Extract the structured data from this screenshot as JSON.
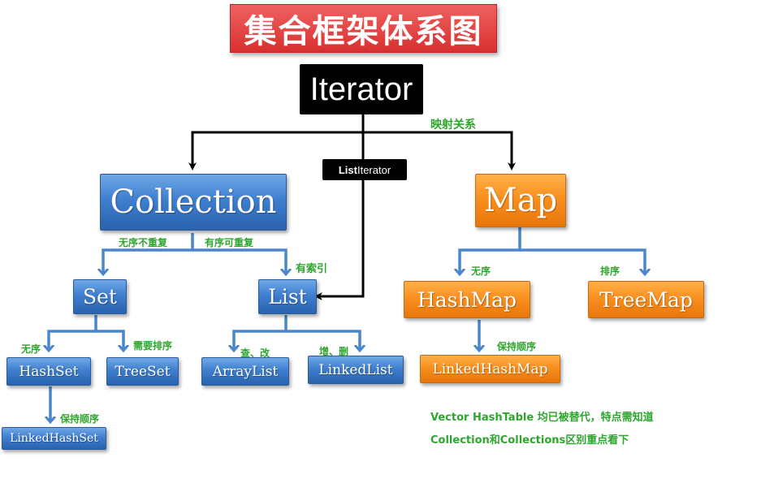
{
  "title": "集合框架体系图",
  "nodes": {
    "iterator": "Iterator",
    "list_iterator_bold": "List",
    "list_iterator_rest": "Iterator",
    "collection": "Collection",
    "map": "Map",
    "set": "Set",
    "list": "List",
    "hashset": "HashSet",
    "treeset": "TreeSet",
    "arraylist": "ArrayList",
    "linkedlist": "LinkedList",
    "linkedhashset": "LinkedHashSet",
    "hashmap": "HashMap",
    "treemap": "TreeMap",
    "linkedhashmap": "LinkedHashMap"
  },
  "labels": {
    "mapping": "映射关系",
    "unordered_no_dup": "无序不重复",
    "ordered_dup": "有序可重复",
    "indexed": "有索引",
    "set_unordered": "无序",
    "needs_sort": "需要排序",
    "query_modify": "查、改",
    "add_delete": "增、删",
    "keep_order_set": "保持顺序",
    "map_unordered": "无序",
    "map_sorted": "排序",
    "keep_order_map": "保持顺序"
  },
  "notes": {
    "line1": "Vector HashTable 均已被替代，特点需知道",
    "line2": "Collection和Collections区别重点看下"
  },
  "colors": {
    "title_red": "#d83030",
    "interface_blue": "#3f7fcf",
    "map_orange": "#f8901e",
    "label_green": "#2ea62e",
    "arrow_blue": "#4a86cc"
  }
}
